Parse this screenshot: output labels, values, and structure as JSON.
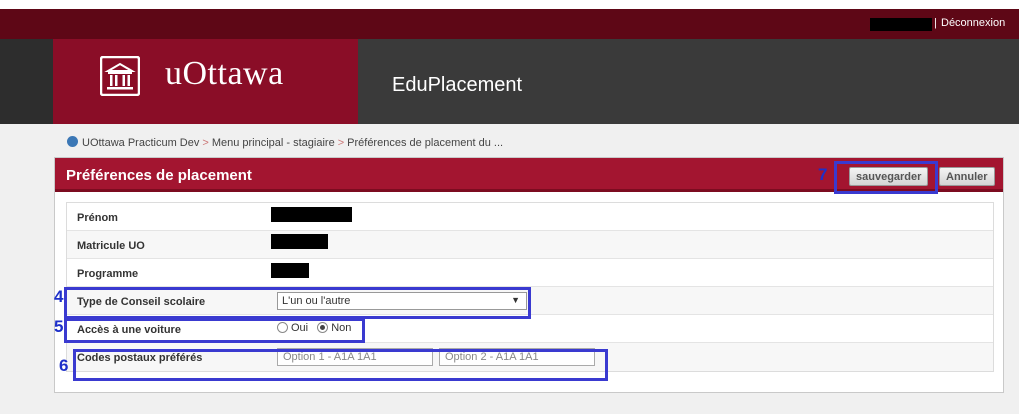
{
  "header": {
    "logout_label": "Déconnexion",
    "separator": "|"
  },
  "banner": {
    "logo_text": "uOttawa",
    "app_name": "EduPlacement"
  },
  "breadcrumb": {
    "items": [
      "UOttawa Practicum Dev",
      "Menu principal - stagiaire",
      "Préférences de placement du ..."
    ],
    "separator": ">"
  },
  "panel": {
    "title": "Préférences de placement",
    "save_label": "sauvegarder",
    "cancel_label": "Annuler"
  },
  "annotations": {
    "save": "7",
    "board_type": "4",
    "car_access": "5",
    "postal_codes": "6"
  },
  "fields": {
    "first_name_label": "Prénom",
    "student_id_label": "Matricule UO",
    "program_label": "Programme",
    "board_type_label": "Type de Conseil scolaire",
    "board_type_value": "L'un ou l'autre",
    "car_access_label": "Accès à une voiture",
    "car_options": [
      "Oui",
      "Non"
    ],
    "car_selected": "Non",
    "postal_codes_label": "Codes postaux préférés",
    "postal_option1_placeholder": "Option 1 - A1A 1A1",
    "postal_option2_placeholder": "Option 2 - A1A 1A1"
  },
  "colors": {
    "topbar": "#5e0716",
    "brand": "#8a0d27",
    "panel_header": "#a31530",
    "annotation": "#3a3ad0"
  }
}
